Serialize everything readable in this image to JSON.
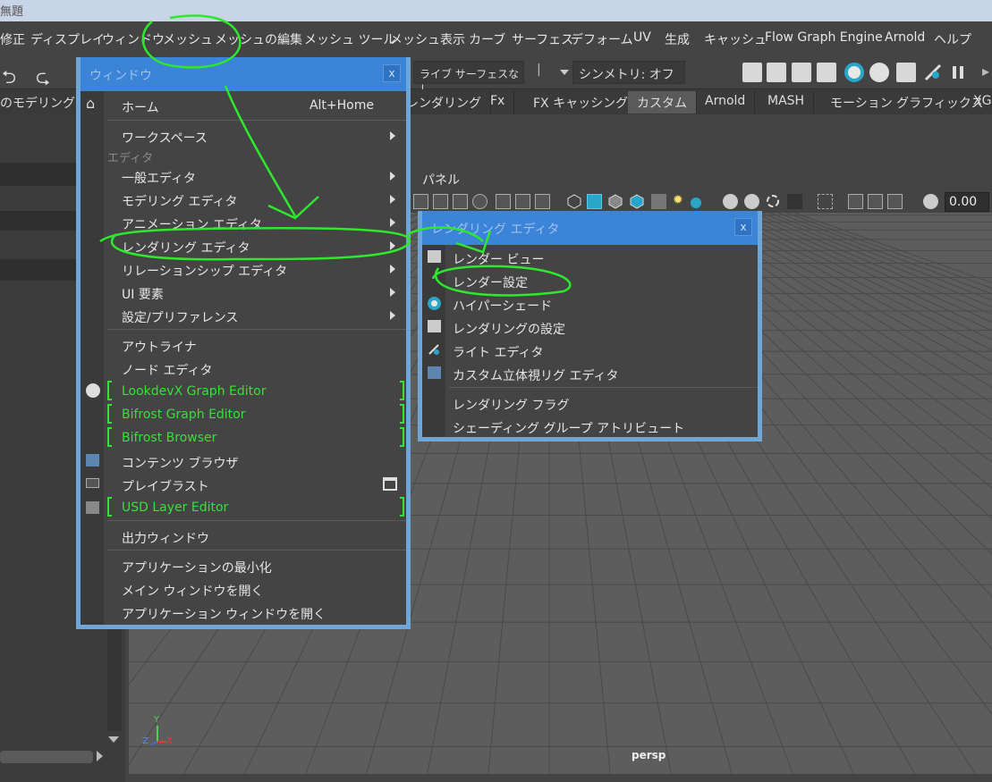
{
  "title_fragment": "無題",
  "menubar": [
    "修正",
    "ディスプレイ",
    "ウィンドウ",
    "メッシュ",
    "メッシュの編集",
    "メッシュ ツール",
    "メッシュ表示",
    "カーブ",
    "サーフェス",
    "デフォーム",
    "UV",
    "生成",
    "キャッシュ",
    "Flow Graph Engine",
    "Arnold",
    "ヘルプ"
  ],
  "toolbar": {
    "live_surface": "ライブ サーフェスなし",
    "symmetry": "シンメトリ: オフ"
  },
  "shelf": {
    "left_fragment": "のモデリング",
    "tabs": [
      "レンダリング",
      "Fx",
      "FX キャッシング",
      "カスタム",
      "Arnold",
      "MASH",
      "モーション グラフィックス",
      "XG"
    ],
    "active_index": 3
  },
  "viewport": {
    "panel_menu": "パネル",
    "value_field": "0.00",
    "camera_label": "persp",
    "axis": {
      "y": "Y",
      "z": "Z",
      "x": "X"
    }
  },
  "window_menu": {
    "title": "ウィンドウ",
    "close": "x",
    "items": {
      "home": "ホーム",
      "home_shortcut": "Alt+Home",
      "workspace": "ワークスペース",
      "section_editor": "エディタ",
      "general": "一般エディタ",
      "modeling": "モデリング エディタ",
      "animation": "アニメーション エディタ",
      "rendering": "レンダリング エディタ",
      "relationship": "リレーションシップ エディタ",
      "ui": "UI 要素",
      "settings": "設定/プリファレンス",
      "outliner": "アウトライナ",
      "node": "ノード エディタ",
      "lookdevx": "LookdevX Graph Editor",
      "bifrost_graph": "Bifrost Graph Editor",
      "bifrost_browser": "Bifrost Browser",
      "content": "コンテンツ ブラウザ",
      "playblast": "プレイブラスト",
      "usd": "USD Layer Editor",
      "output": "出力ウィンドウ",
      "minimize": "アプリケーションの最小化",
      "main_open": "メイン ウィンドウを開く",
      "app_open": "アプリケーション ウィンドウを開く"
    }
  },
  "render_menu": {
    "title": "レンダリング エディタ",
    "close": "x",
    "items": {
      "render_view": "レンダー ビュー",
      "render_settings": "レンダー設定",
      "hypershade": "ハイパーシェード",
      "rendering_settings": "レンダリングの設定",
      "light_editor": "ライト エディタ",
      "stereo": "カスタム立体視リグ エディタ",
      "flags": "レンダリング フラグ",
      "shading": "シェーディング グループ アトリビュート"
    }
  },
  "colors": {
    "menu_header": "#3b84d8",
    "menu_border": "#6fa6d8",
    "annotation": "#2ee82e",
    "plugin_green": "#37e03a"
  }
}
